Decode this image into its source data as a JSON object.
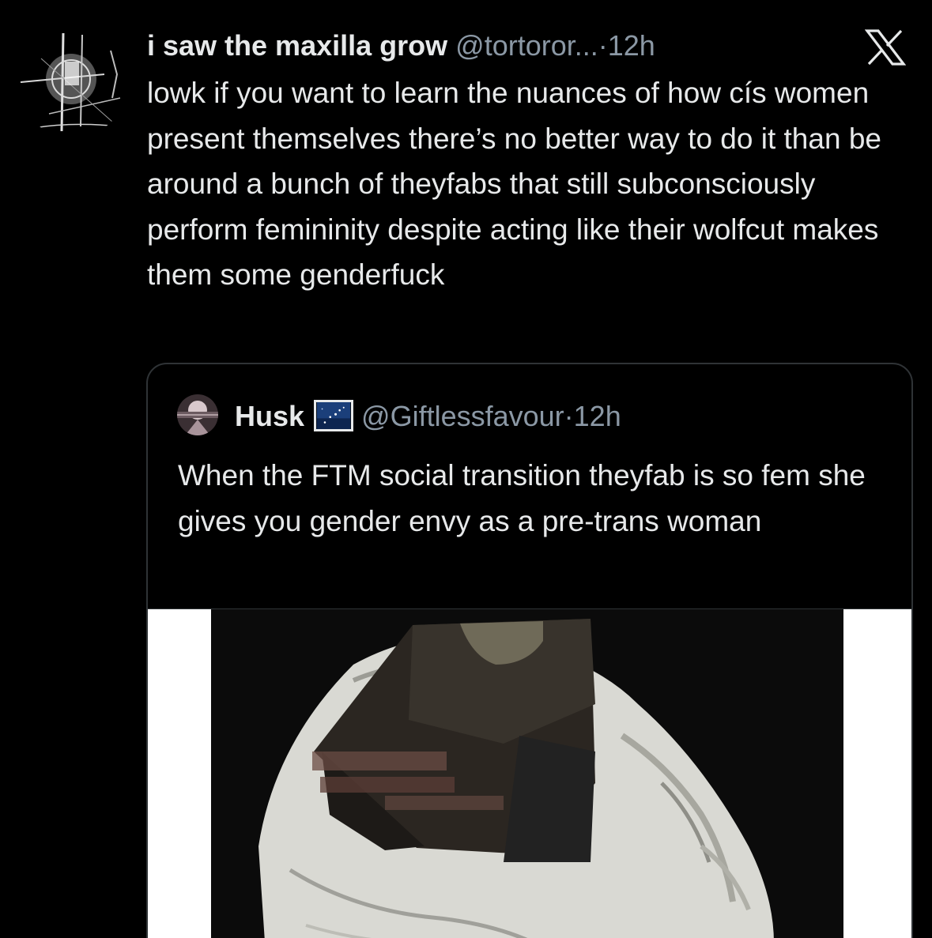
{
  "tweet": {
    "display_name": "i saw the maxilla grow",
    "handle": "@tortoror...",
    "separator": "·",
    "time": "12h",
    "text": "lowk if you want to learn the nuances of how cís women present themselves there’s no better way to do it than be around a bunch of theyfabs that still subconsciously perform femininity despite acting like their wolfcut makes them some genderfuck",
    "avatar_icon": "sketch-avatar-icon",
    "logo_icon": "x-logo-icon"
  },
  "quote": {
    "display_name": "Husk",
    "handle": "@Giftlessfavour",
    "separator": "·",
    "time": "12h",
    "text": "When the FTM social transition theyfab is so fem she gives you gender envy as a pre-trans woman",
    "flag_icon": "night-sky-flag-icon",
    "media_icon": "statue-meme-image"
  },
  "colors": {
    "background": "#000000",
    "text_primary": "#e7e9ea",
    "text_secondary": "#8b98a5",
    "border": "#2f3336"
  }
}
